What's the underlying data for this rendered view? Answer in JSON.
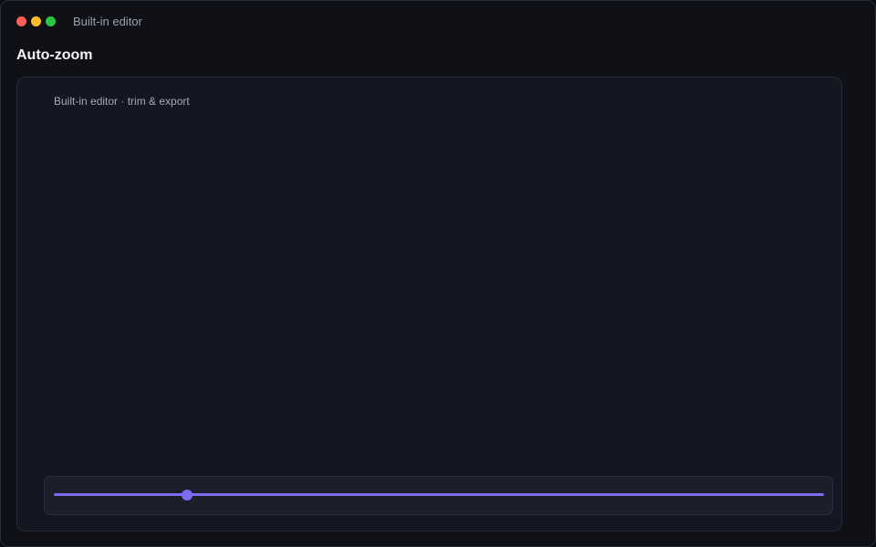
{
  "window": {
    "title": "Built-in editor"
  },
  "page": {
    "title": "Auto-zoom"
  },
  "editor": {
    "caption": "Built-in editor · trim & export",
    "timeline": {
      "playhead_fraction": 0.173
    }
  },
  "colors": {
    "accent": "#7b6cf0",
    "close": "#ff5f57",
    "minimize": "#febc2e",
    "maximize": "#28c840"
  }
}
